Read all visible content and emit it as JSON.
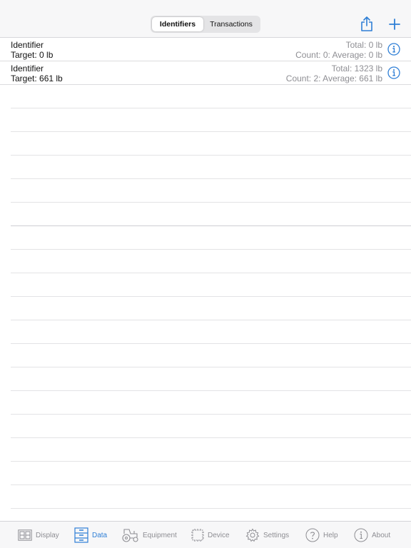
{
  "header": {
    "segments": [
      "Identifiers",
      "Transactions"
    ],
    "selected_segment": "Identifiers",
    "share_icon": "share-icon",
    "add_icon": "plus-icon"
  },
  "rows": [
    {
      "title": "Identifier",
      "target": "Target: 0 lb",
      "total": "Total: 0 lb",
      "stats": "Count: 0: Average: 0 lb"
    },
    {
      "title": "Identifier",
      "target": "Target: 661 lb",
      "total": "Total: 1323 lb",
      "stats": "Count: 2: Average: 661 lb"
    }
  ],
  "tabbar": {
    "active": "Data",
    "items": [
      {
        "label": "Display",
        "icon": "display-icon"
      },
      {
        "label": "Data",
        "icon": "data-drawer-icon"
      },
      {
        "label": "Equipment",
        "icon": "tractor-icon"
      },
      {
        "label": "Device",
        "icon": "device-chip-icon"
      },
      {
        "label": "Settings",
        "icon": "gear-icon"
      },
      {
        "label": "Help",
        "icon": "help-icon"
      },
      {
        "label": "About",
        "icon": "info-icon"
      }
    ]
  },
  "colors": {
    "accent": "#2f7fd6",
    "secondary_text": "#8e8e93",
    "bar_background": "#f7f7f8"
  }
}
